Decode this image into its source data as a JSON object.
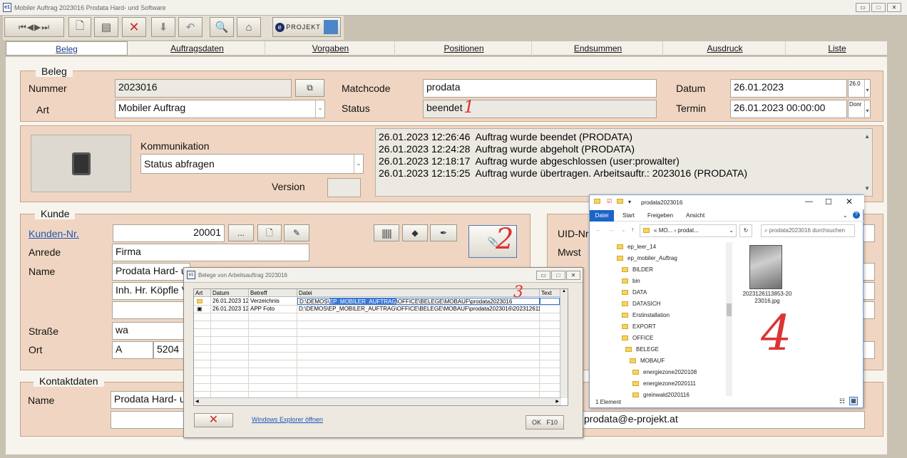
{
  "window": {
    "title": "Mobiler Auftrag  2023016  Prodata Hard- und Software",
    "icon": "e1"
  },
  "toolbar": {
    "logo_text": "PROJEKT"
  },
  "tabs": [
    "Beleg",
    "Auftragsdaten",
    "Vorgaben",
    "Positionen",
    "Endsummen",
    "Ausdruck",
    "Liste"
  ],
  "beleg": {
    "legend": "Beleg",
    "nummer_label": "Nummer",
    "nummer": "2023016",
    "art_label": "Art",
    "art": "Mobiler Auftrag",
    "matchcode_label": "Matchcode",
    "matchcode": "prodata",
    "status_label": "Status",
    "status": "beendet",
    "datum_label": "Datum",
    "datum": "26.01.2023",
    "datum_small": "26.0",
    "termin_label": "Termin",
    "termin": "26.01.2023 00:00:00",
    "termin_small": "Donr"
  },
  "kommunikation": {
    "label": "Kommunikation",
    "value": "Status abfragen",
    "version_label": "Version",
    "log": [
      "26.01.2023 12:26:46  Auftrag wurde beendet (PRODATA)",
      "26.01.2023 12:24:28  Auftrag wurde abgeholt (PRODATA)",
      "26.01.2023 12:18:17  Auftrag wurde abgeschlossen (user:prowalter)",
      "26.01.2023 12:15:25  Auftrag wurde übertragen. Arbeitsauftr.: 2023016 (PRODATA)"
    ]
  },
  "kunde": {
    "legend": "Kunde",
    "nr_label": "Kunden-Nr.",
    "nr": "20001",
    "more": "...",
    "anrede_label": "Anrede",
    "anrede": "Firma",
    "name_label": "Name",
    "name1": "Prodata Hard- u",
    "name2": "Inh. Hr. Köpfle V",
    "strasse_label": "Straße",
    "strasse": "wa",
    "ort_label": "Ort",
    "land": "A",
    "plz": "5204"
  },
  "right": {
    "uid_label": "UID-Nr",
    "mwst_label": "Mwst"
  },
  "kontakt": {
    "legend": "Kontaktdaten",
    "name_label": "Name",
    "name": "Prodata Hard- u",
    "email": "prodata@e-projekt.at"
  },
  "dialog": {
    "title": "Belege von Arbeitsauftrag 2023016",
    "columns": [
      "Art",
      "Datum",
      "Betreff",
      "Datei",
      "Text"
    ],
    "rows": [
      {
        "datum": "26.01.2023 12",
        "betreff": "Verzeichnis",
        "datei_a": "D:\\DEMOS\\",
        "datei_hl": "EP_MOBILER_AUFTRAG",
        "datei_b": "\\OFFICE\\BELEGE\\MOBAUF\\prodata2023016"
      },
      {
        "datum": "26.01.2023 12",
        "betreff": "APP Foto",
        "datei_a": "D:\\DEMOS\\EP_MOBILER_AUFTRAG\\OFFICE\\BELEGE\\MOBAUF\\prodata2023016\\2023126113",
        "datei_hl": "",
        "datei_b": ""
      }
    ],
    "explorer_link": "Windows Explorer öffnen",
    "ok_label": "OK",
    "ok_key": "F10"
  },
  "explorer": {
    "title": "prodata2023016",
    "ribbon": [
      "Datei",
      "Start",
      "Freigeben",
      "Ansicht"
    ],
    "address": [
      "«",
      "MO...",
      "›",
      "prodat..."
    ],
    "search_placeholder": "prodata2023016 durchsuchen",
    "tree": [
      "ep_leer_14",
      "ep_mobiler_Auftrag",
      "BILDER",
      "bin",
      "DATA",
      "DATASICH",
      "Erstinstallation",
      "EXPORT",
      "OFFICE",
      "BELEGE",
      "MOBAUF",
      "energiezone2020108",
      "energiezone2020111",
      "greinwald2020116"
    ],
    "file_name": "2023126113853-2023016.jpg",
    "status": "1 Element"
  },
  "annotations": [
    "1",
    "2",
    "3",
    "4"
  ]
}
